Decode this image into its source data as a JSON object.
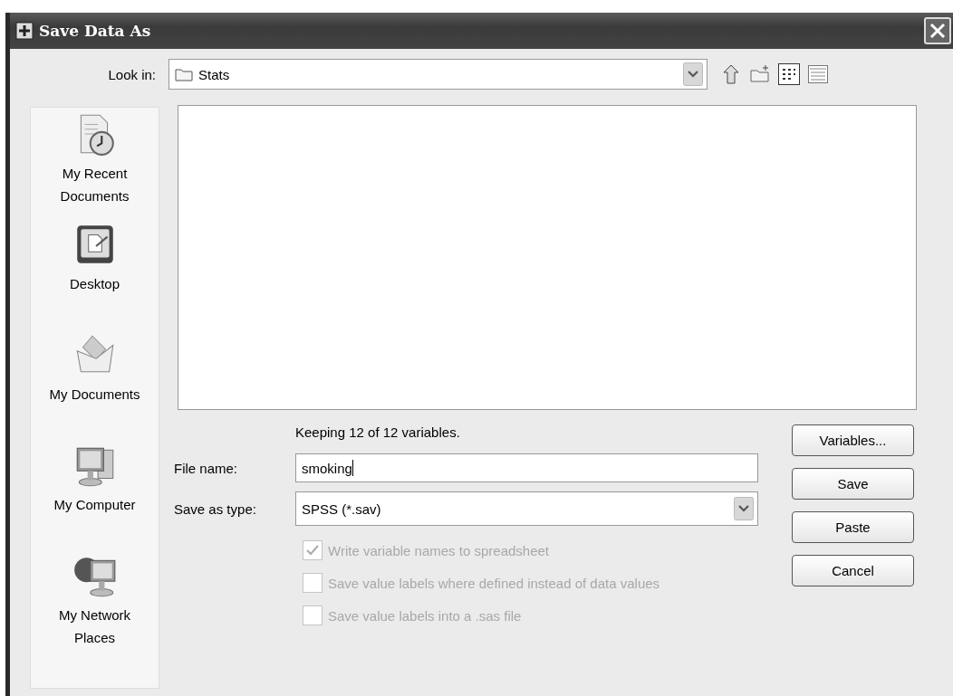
{
  "window": {
    "title": "Save Data As"
  },
  "look_in": {
    "label": "Look in:",
    "value": "Stats"
  },
  "places": [
    {
      "kind": "recent",
      "label": "My Recent Documents"
    },
    {
      "kind": "desktop",
      "label": "Desktop"
    },
    {
      "kind": "documents",
      "label": "My Documents"
    },
    {
      "kind": "computer",
      "label": "My Computer"
    },
    {
      "kind": "network",
      "label": "My Network Places"
    }
  ],
  "status": "Keeping 12 of 12 variables.",
  "file_name": {
    "label": "File name:",
    "value": "smoking"
  },
  "save_as_type": {
    "label": "Save as type:",
    "value": "SPSS (*.sav)"
  },
  "options": [
    {
      "label": "Write variable names to spreadsheet",
      "checked": true,
      "disabled": true
    },
    {
      "label": "Save value labels where defined instead of data values",
      "checked": false,
      "disabled": true
    },
    {
      "label": "Save value labels into a .sas file",
      "checked": false,
      "disabled": true
    }
  ],
  "buttons": [
    "Variables...",
    "Save",
    "Paste",
    "Cancel"
  ]
}
